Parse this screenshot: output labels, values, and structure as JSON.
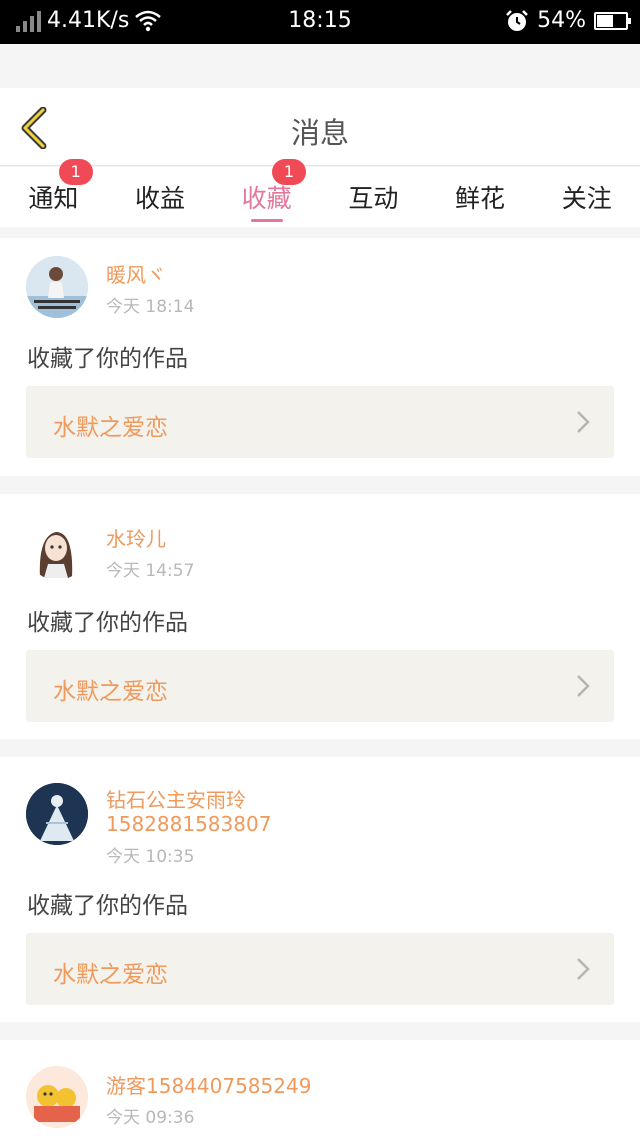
{
  "status_bar": {
    "network_speed": "4.41K/s",
    "time": "18:15",
    "battery_percent": "54%"
  },
  "header": {
    "title": "消息"
  },
  "tabs": [
    {
      "label": "通知",
      "badge": "1",
      "active": false
    },
    {
      "label": "收益",
      "badge": "",
      "active": false
    },
    {
      "label": "收藏",
      "badge": "1",
      "active": true
    },
    {
      "label": "互动",
      "badge": "",
      "active": false
    },
    {
      "label": "鲜花",
      "badge": "",
      "active": false
    },
    {
      "label": "关注",
      "badge": "",
      "active": false
    }
  ],
  "colors": {
    "accent_pink": "#e5779d",
    "name_orange": "#ef9a5c",
    "badge_red": "#f04a56"
  },
  "items": [
    {
      "name": "暖风ヾ",
      "time": "今天 18:14",
      "action": "收藏了你的作品",
      "work_title": "水默之爱恋"
    },
    {
      "name": "水玲儿",
      "time": "今天 14:57",
      "action": "收藏了你的作品",
      "work_title": "水默之爱恋"
    },
    {
      "name": "钻石公主安雨玲",
      "name_line2": "1582881583807",
      "time": "今天 10:35",
      "action": "收藏了你的作品",
      "work_title": "水默之爱恋"
    },
    {
      "name": "游客1584407585249",
      "time": "今天 09:36"
    }
  ]
}
